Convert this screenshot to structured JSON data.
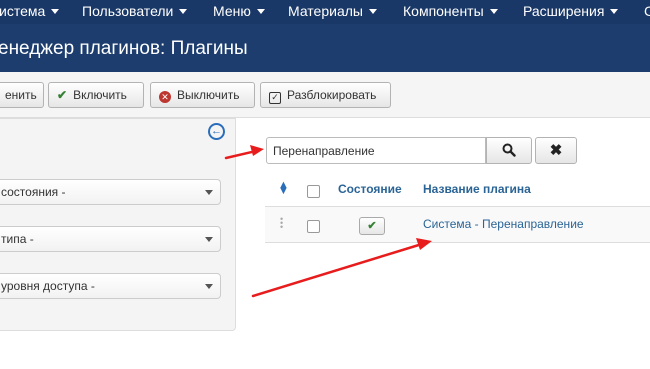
{
  "navbar": {
    "items": [
      {
        "label": "истема"
      },
      {
        "label": "Пользователи"
      },
      {
        "label": "Меню"
      },
      {
        "label": "Материалы"
      },
      {
        "label": "Компоненты"
      },
      {
        "label": "Расширения"
      },
      {
        "label": "С"
      }
    ]
  },
  "header": {
    "title": "енеджер плагинов: Плагины"
  },
  "toolbar": {
    "edit_label": "енить",
    "enable_label": "Включить",
    "disable_label": "Выключить",
    "unlock_label": "Разблокировать"
  },
  "sidebar": {
    "filters": [
      {
        "selected": "состояния -"
      },
      {
        "selected": "типа -"
      },
      {
        "selected": "уровня доступа -"
      }
    ]
  },
  "search": {
    "value": "Перенаправление"
  },
  "table": {
    "headers": {
      "state": "Состояние",
      "name": "Название плагина"
    },
    "rows": [
      {
        "name": "Система - Перенаправление",
        "enabled": true
      }
    ]
  },
  "annotation_color": "#e81c1c",
  "accent_color": "#1c3d6e"
}
